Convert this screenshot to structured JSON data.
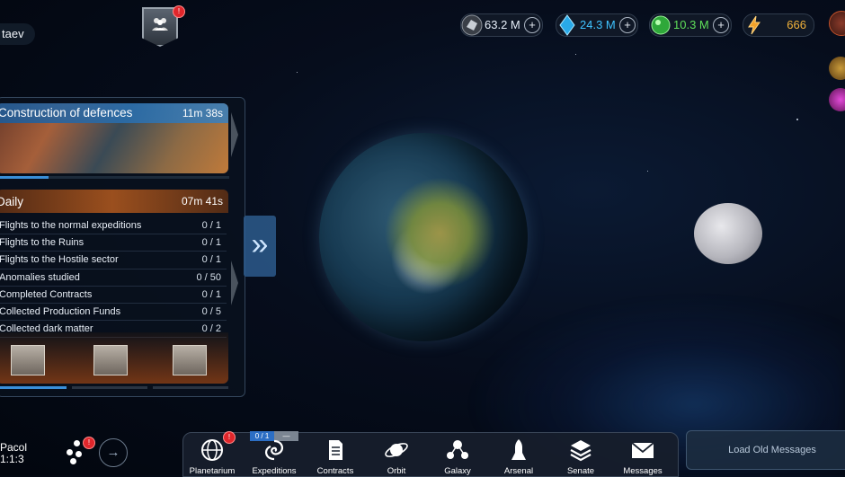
{
  "player": {
    "name": "taev"
  },
  "alliance": {
    "notification": "!"
  },
  "resources": [
    {
      "name": "metal",
      "value": "63.2 M",
      "icon": "metal-icon",
      "color": "#e8eef6"
    },
    {
      "name": "crystal",
      "value": "24.3 M",
      "icon": "crystal-icon",
      "color": "#3fc3ff"
    },
    {
      "name": "deuterium",
      "value": "10.3 M",
      "icon": "deuterium-icon",
      "color": "#5fe05a"
    },
    {
      "name": "energy",
      "value": "666",
      "icon": "lightning-icon",
      "color": "#f2b23a"
    }
  ],
  "quest": {
    "title": "Construction of defences",
    "timer": "11m 38s",
    "progress": 0.21
  },
  "daily": {
    "title": "Daily",
    "timer": "07m 41s",
    "tasks": [
      {
        "name": "Flights to the normal expeditions",
        "count": "0 / 1"
      },
      {
        "name": "Flights to the Ruins",
        "count": "0 / 1"
      },
      {
        "name": "Flights to the Hostile sector",
        "count": "0 / 1"
      },
      {
        "name": "Anomalies studied",
        "count": "0 / 50"
      },
      {
        "name": "Completed Contracts",
        "count": "0 / 1"
      },
      {
        "name": "Collected Production Funds",
        "count": "0 / 5"
      },
      {
        "name": "Collected dark matter",
        "count": "0 / 2"
      }
    ]
  },
  "planet_info": {
    "name": "Pacol",
    "coords": "1:1:3"
  },
  "cluster_badge": "!",
  "nav": {
    "expedition_counter": "0 / 1",
    "expedition_counter_extra": "—",
    "items": [
      {
        "label": "Planetarium",
        "icon": "globe-icon",
        "badge": "!"
      },
      {
        "label": "Expeditions",
        "icon": "vortex-icon"
      },
      {
        "label": "Contracts",
        "icon": "document-icon"
      },
      {
        "label": "Orbit",
        "icon": "orbit-icon"
      },
      {
        "label": "Galaxy",
        "icon": "galaxy-icon"
      },
      {
        "label": "Arsenal",
        "icon": "rocket-icon"
      },
      {
        "label": "Senate",
        "icon": "senate-icon"
      },
      {
        "label": "Messages",
        "icon": "envelope-icon"
      }
    ]
  },
  "messages": {
    "load_label": "Load Old Messages"
  },
  "colors": {
    "accent": "#3a8fd8",
    "panel": "#0a121e",
    "badge": "#e0262b"
  }
}
